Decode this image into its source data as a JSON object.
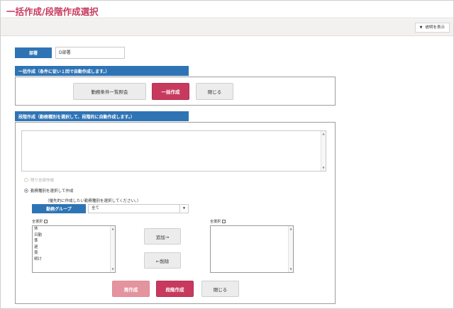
{
  "page": {
    "title": "一括作成/段階作成選択"
  },
  "toolbar": {
    "help_label": "説明を表示"
  },
  "department": {
    "label": "部署",
    "value": "D部署"
  },
  "bulk": {
    "header": "一括作成（条件に従い１回で自動作成します。）",
    "list_button": "勤務条件一覧照会",
    "create_button": "一括作成",
    "close_button": "閉じる"
  },
  "stepwise": {
    "header": "段階作成（勤務種別を選択して、段階的に自動作成します。）",
    "radio_remaining": "残り全部作成",
    "radio_select": "勤務種別を選択して作成",
    "hint": "（優先的に作成したい勤務種別を選択してください。）",
    "group_label": "勤務グループ",
    "group_value": "全て",
    "select_all_left": "全選択",
    "select_all_right": "全選択",
    "left_items": [
      "休",
      "日勤",
      "準",
      "遅",
      "夜",
      "明け"
    ],
    "add_button": "追加→",
    "remove_button": "←削除",
    "recreate_button": "再作成",
    "create_button": "段階作成",
    "close_button": "閉じる"
  }
}
